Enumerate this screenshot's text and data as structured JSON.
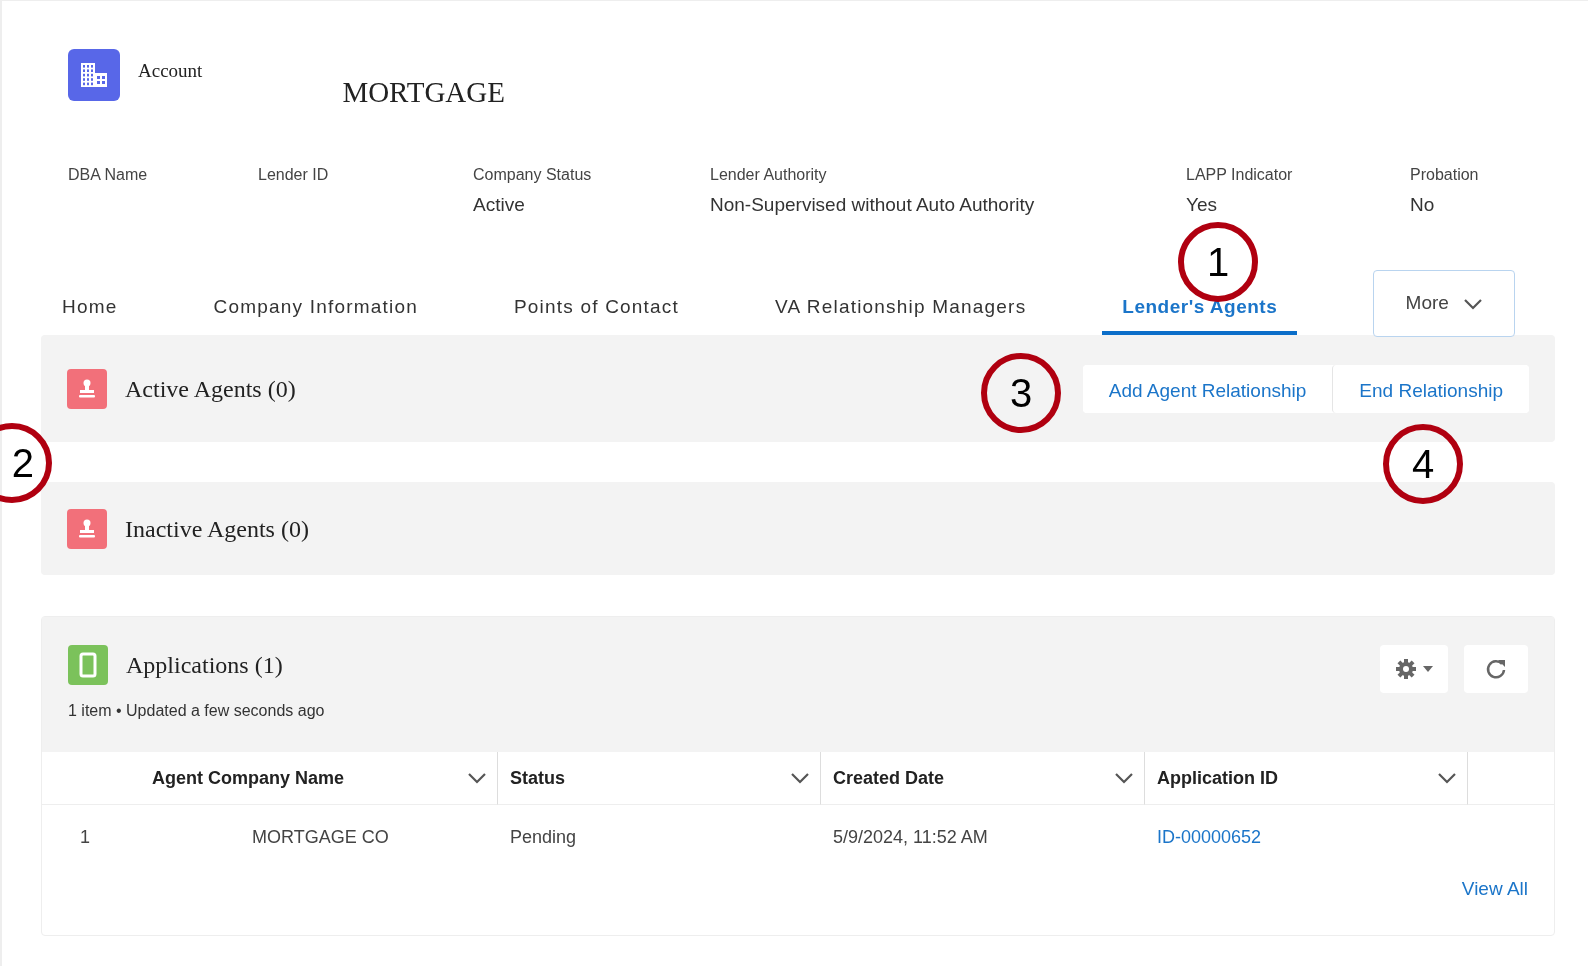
{
  "header": {
    "object_type": "Account",
    "title": "MORTGAGE"
  },
  "fields": [
    {
      "label": "DBA Name"
    },
    {
      "label": "Lender ID"
    },
    {
      "label": "Company Status",
      "value": "Active"
    },
    {
      "label": "Lender Authority",
      "value": "Non-Supervised without Auto Authority"
    },
    {
      "label": "LAPP Indicator",
      "value": "Yes"
    },
    {
      "label": "Probation",
      "value": "No"
    }
  ],
  "tabs": [
    {
      "label": "Home",
      "selected": false
    },
    {
      "label": "Company Information",
      "selected": false
    },
    {
      "label": "Points of Contact",
      "selected": false
    },
    {
      "label": "VA Relationship Managers",
      "selected": false
    },
    {
      "label": "Lender's Agents",
      "selected": true
    }
  ],
  "more_button": {
    "label": "More"
  },
  "sections": [
    {
      "title": "Active Agents (0)",
      "actions": [
        "Add Agent Relationship",
        "End Relationship"
      ]
    },
    {
      "title": "Inactive Agents (0)"
    }
  ],
  "applications": {
    "title": "Applications (1)",
    "meta": "1 item • Updated a few seconds ago",
    "columns": [
      "Agent Company Name",
      "Status",
      "Created Date",
      "Application ID"
    ],
    "rows": [
      {
        "number": "1",
        "cells": [
          "MORTGAGE CO",
          "Pending",
          "5/9/2024, 11:52 AM",
          "ID-00000652"
        ]
      }
    ],
    "view_all": "View All"
  },
  "callouts": [
    {
      "label": "1"
    },
    {
      "label": "2"
    },
    {
      "label": "3"
    },
    {
      "label": "4"
    }
  ]
}
